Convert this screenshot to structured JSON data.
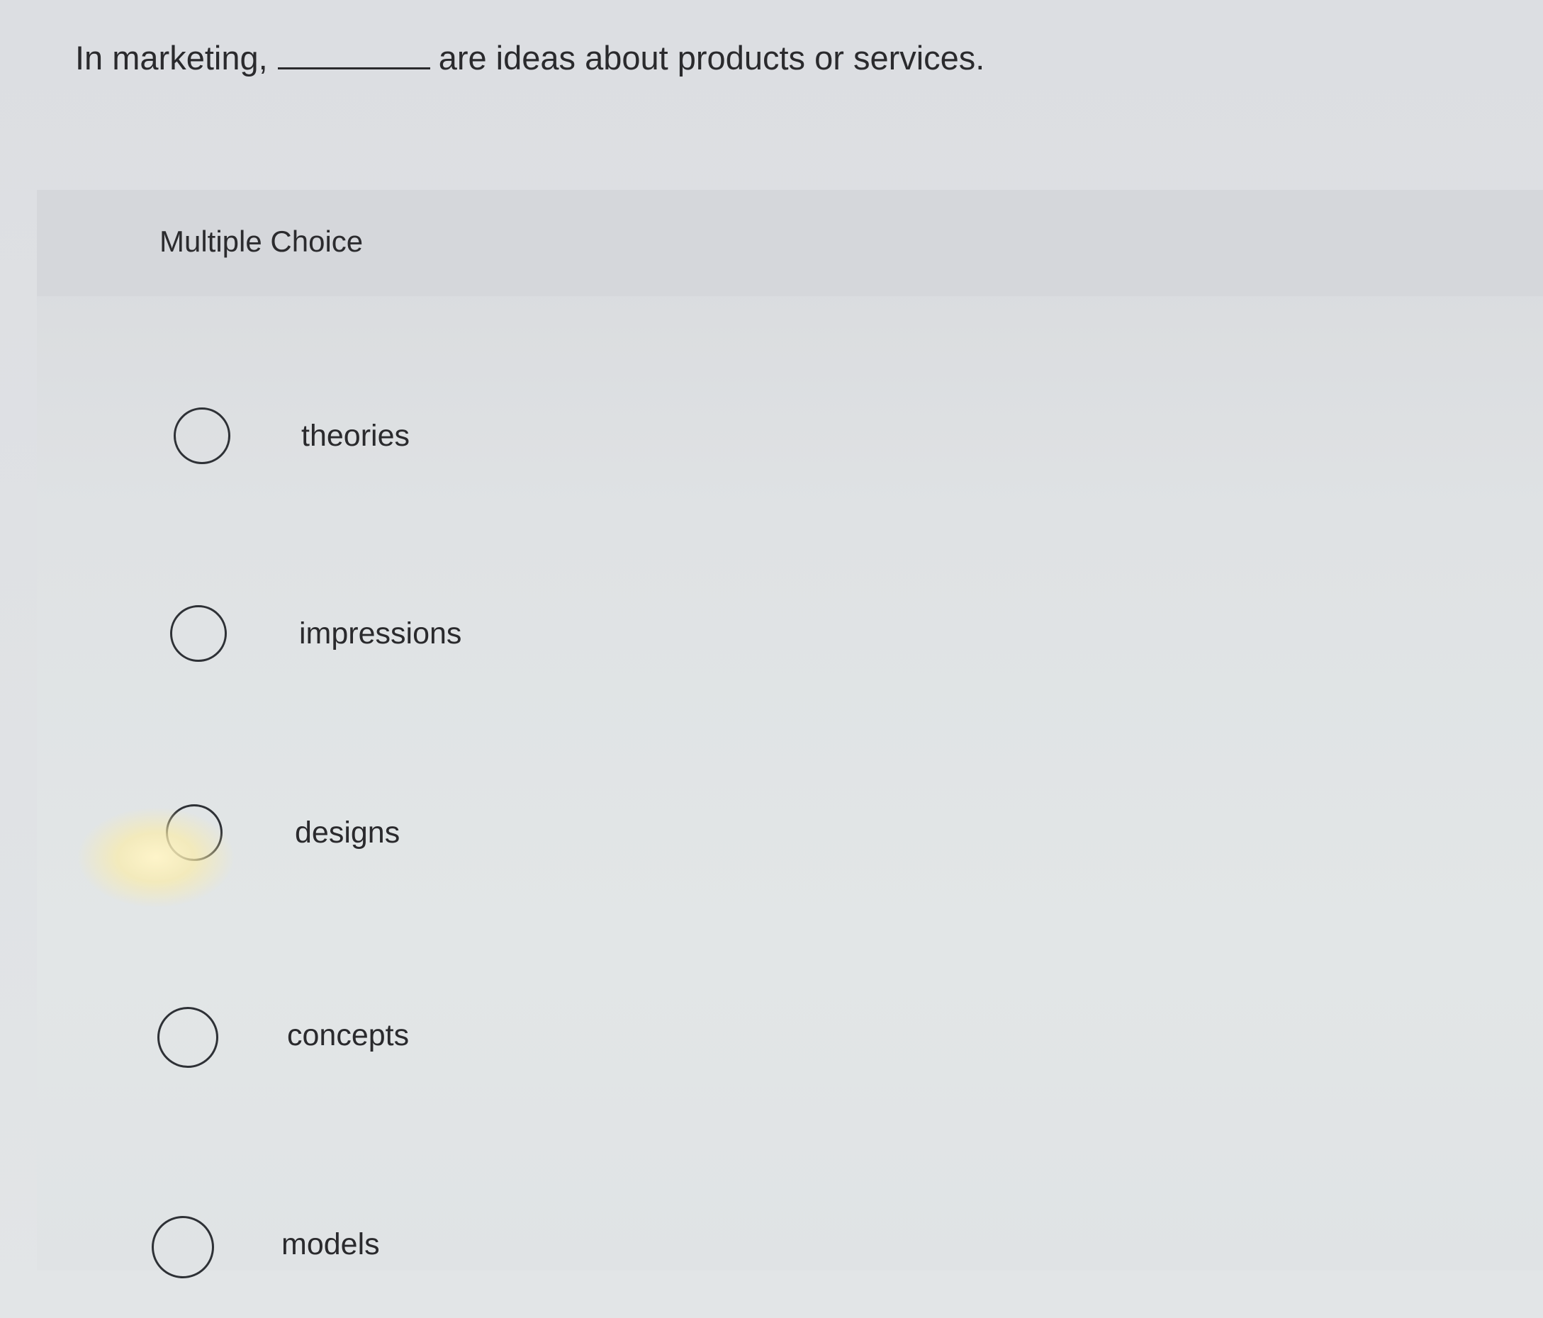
{
  "question": {
    "prefix": "In marketing,",
    "suffix": "are ideas about products or services."
  },
  "multiple_choice": {
    "title": "Multiple Choice",
    "options": [
      {
        "label": "theories",
        "selected": false
      },
      {
        "label": "impressions",
        "selected": false
      },
      {
        "label": "designs",
        "selected": false
      },
      {
        "label": "concepts",
        "selected": false
      },
      {
        "label": "models",
        "selected": false
      }
    ]
  }
}
